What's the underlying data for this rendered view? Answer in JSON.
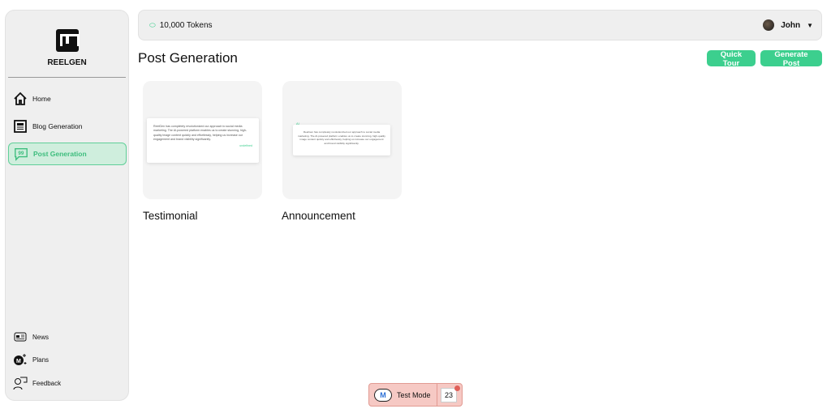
{
  "brand": {
    "name": "REELGEN"
  },
  "sidebar": {
    "items": [
      {
        "label": "Home",
        "icon": "home-icon"
      },
      {
        "label": "Blog Generation",
        "icon": "document-icon"
      },
      {
        "label": "Post Generation",
        "icon": "quote-bubble-icon",
        "active": true
      }
    ],
    "bottom": [
      {
        "label": "News",
        "icon": "newspaper-icon"
      },
      {
        "label": "Plans",
        "icon": "plans-icon"
      },
      {
        "label": "Feedback",
        "icon": "feedback-icon"
      }
    ]
  },
  "header": {
    "tokens": "10,000 Tokens",
    "user": "John"
  },
  "page": {
    "title": "Post Generation",
    "quick_tour": "Quick Tour",
    "generate_post": "Generate Post"
  },
  "templates": [
    {
      "title": "Testimonial",
      "preview_text": "ReelGen has completely revolutionized our approach to social media marketing. The AI-powered platform enables us to create stunning, high-quality image content quickly and effortlessly, helping us increase our engagement and brand visibility significantly.",
      "preview_author": "undefined"
    },
    {
      "title": "Announcement",
      "preview_text": "ReelGen has completely revolutionized our approach to social media marketing. The AI-powered platform enables us to create stunning, high-quality image content quickly and effortlessly, helping us increase our engagement and brand visibility significantly.",
      "preview_tag": "AI"
    }
  ],
  "test_mode": {
    "label": "Test Mode",
    "count": "23"
  },
  "colors": {
    "accent": "#3ccf8e",
    "active_bg": "#cfeedd"
  }
}
